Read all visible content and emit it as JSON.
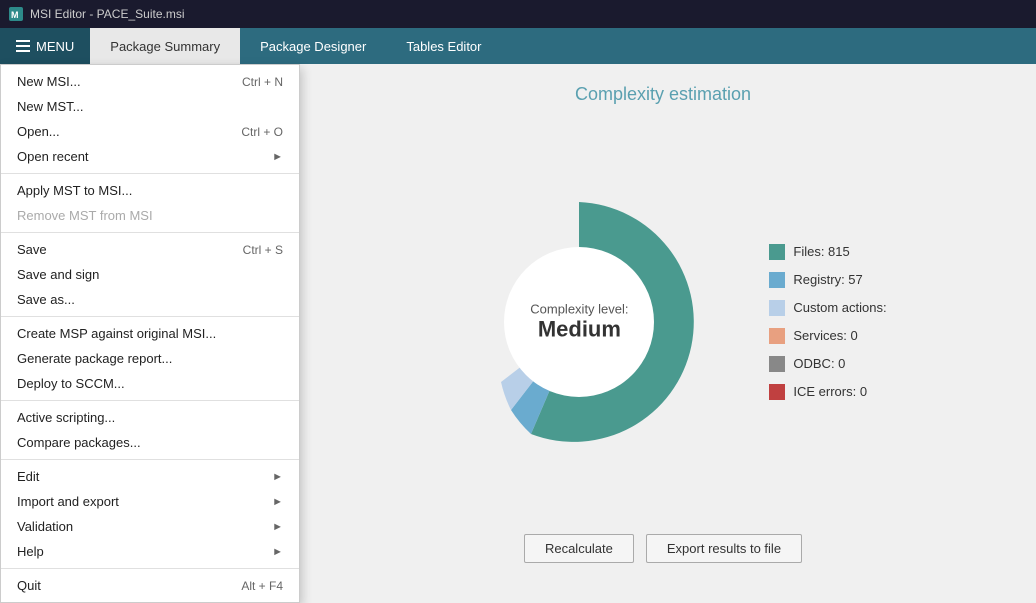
{
  "titleBar": {
    "icon": "msi-icon",
    "title": "MSI Editor - PACE_Suite.msi"
  },
  "navBar": {
    "menuLabel": "MENU",
    "tabs": [
      {
        "label": "Package Summary",
        "active": true
      },
      {
        "label": "Package Designer",
        "active": false
      },
      {
        "label": "Tables Editor",
        "active": false
      }
    ]
  },
  "menu": {
    "items": [
      {
        "label": "New MSI...",
        "shortcut": "Ctrl + N",
        "hasArrow": false,
        "disabled": false,
        "dividerAfter": false
      },
      {
        "label": "New MST...",
        "shortcut": "",
        "hasArrow": false,
        "disabled": false,
        "dividerAfter": false
      },
      {
        "label": "Open...",
        "shortcut": "Ctrl + O",
        "hasArrow": false,
        "disabled": false,
        "dividerAfter": false
      },
      {
        "label": "Open recent",
        "shortcut": "",
        "hasArrow": true,
        "disabled": false,
        "dividerAfter": true
      },
      {
        "label": "Apply MST to MSI...",
        "shortcut": "",
        "hasArrow": false,
        "disabled": false,
        "dividerAfter": false
      },
      {
        "label": "Remove MST from MSI",
        "shortcut": "",
        "hasArrow": false,
        "disabled": true,
        "dividerAfter": true
      },
      {
        "label": "Save",
        "shortcut": "Ctrl + S",
        "hasArrow": false,
        "disabled": false,
        "dividerAfter": false
      },
      {
        "label": "Save and sign",
        "shortcut": "",
        "hasArrow": false,
        "disabled": false,
        "dividerAfter": false
      },
      {
        "label": "Save as...",
        "shortcut": "",
        "hasArrow": false,
        "disabled": false,
        "dividerAfter": true
      },
      {
        "label": "Create MSP against original MSI...",
        "shortcut": "",
        "hasArrow": false,
        "disabled": false,
        "dividerAfter": false
      },
      {
        "label": "Generate package report...",
        "shortcut": "",
        "hasArrow": false,
        "disabled": false,
        "dividerAfter": false
      },
      {
        "label": "Deploy to SCCM...",
        "shortcut": "",
        "hasArrow": false,
        "disabled": false,
        "dividerAfter": true
      },
      {
        "label": "Active scripting...",
        "shortcut": "",
        "hasArrow": false,
        "disabled": false,
        "dividerAfter": false
      },
      {
        "label": "Compare packages...",
        "shortcut": "",
        "hasArrow": false,
        "disabled": false,
        "dividerAfter": true
      },
      {
        "label": "Edit",
        "shortcut": "",
        "hasArrow": true,
        "disabled": false,
        "dividerAfter": false
      },
      {
        "label": "Import and export",
        "shortcut": "",
        "hasArrow": true,
        "disabled": false,
        "dividerAfter": false
      },
      {
        "label": "Validation",
        "shortcut": "",
        "hasArrow": true,
        "disabled": false,
        "dividerAfter": false
      },
      {
        "label": "Help",
        "shortcut": "",
        "hasArrow": true,
        "disabled": false,
        "dividerAfter": true
      },
      {
        "label": "Quit",
        "shortcut": "Alt + F4",
        "hasArrow": false,
        "disabled": false,
        "dividerAfter": false
      }
    ]
  },
  "chart": {
    "title": "Complexity estimation",
    "centerLabel": "Complexity level:",
    "centerValue": "Medium",
    "legend": [
      {
        "label": "Files: 815",
        "color": "#4a9a8f"
      },
      {
        "label": "Registry: 57",
        "color": "#6aabcf"
      },
      {
        "label": "Custom actions:",
        "color": "#b8cfe8"
      },
      {
        "label": "Services: 0",
        "color": "#e8a080"
      },
      {
        "label": "ODBC: 0",
        "color": "#888888"
      },
      {
        "label": "ICE errors: 0",
        "color": "#c04040"
      }
    ],
    "donut": {
      "segments": [
        {
          "value": 815,
          "color": "#4a9a8f",
          "label": "Files"
        },
        {
          "value": 57,
          "color": "#6aabcf",
          "label": "Registry"
        },
        {
          "value": 10,
          "color": "#b8cfe8",
          "label": "Custom actions"
        },
        {
          "value": 0,
          "color": "#e8a080",
          "label": "Services"
        },
        {
          "value": 0,
          "color": "#888888",
          "label": "ODBC"
        },
        {
          "value": 0,
          "color": "#c04040",
          "label": "ICE errors"
        }
      ]
    }
  },
  "buttons": {
    "recalculate": "Recalculate",
    "exportResults": "Export results to file"
  }
}
